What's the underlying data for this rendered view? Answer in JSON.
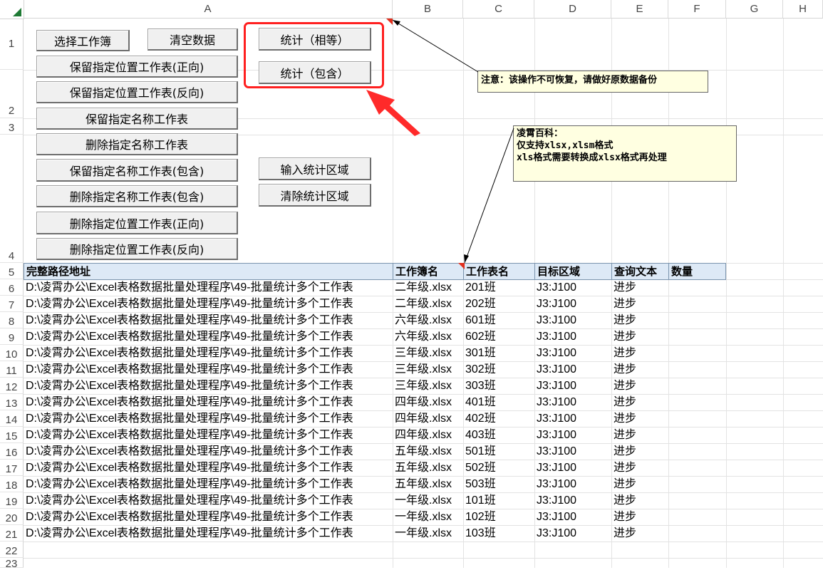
{
  "columns": [
    "A",
    "B",
    "C",
    "D",
    "E",
    "F",
    "G",
    "H"
  ],
  "rows": [
    "1",
    "2",
    "3",
    "4",
    "5",
    "6",
    "7",
    "8",
    "9",
    "10",
    "11",
    "12",
    "13",
    "14",
    "15",
    "16",
    "17",
    "18",
    "19",
    "20",
    "21",
    "22",
    "23"
  ],
  "buttons": {
    "select_workbook": "选择工作簿",
    "clear_data": "清空数据",
    "keep_pos_forward": "保留指定位置工作表(正向)",
    "keep_pos_reverse": "保留指定位置工作表(反向)",
    "keep_name": "保留指定名称工作表",
    "delete_name": "删除指定名称工作表",
    "keep_name_contains": "保留指定名称工作表(包含)",
    "delete_name_contains": "删除指定名称工作表(包含)",
    "delete_pos_forward": "删除指定位置工作表(正向)",
    "delete_pos_reverse": "删除指定位置工作表(反向)",
    "stat_equal": "统计（相等）",
    "stat_contains": "统计（包含）",
    "input_range": "输入统计区域",
    "clear_range": "清除统计区域"
  },
  "notes": {
    "warning": "注意：该操作不可恢复，请做好原数据备份",
    "info_title": "凌霄百科：",
    "info_line1": "仅支持xlsx,xlsm格式",
    "info_line2": "xls格式需要转换成xlsx格式再处理"
  },
  "table": {
    "headers": [
      "完整路径地址",
      "工作簿名",
      "工作表名",
      "目标区域",
      "查询文本",
      "数量"
    ],
    "rows": [
      [
        "D:\\凌霄办公\\Excel表格数据批量处理程序\\49-批量统计多个工作表",
        "二年级.xlsx",
        "201班",
        "J3:J100",
        "进步",
        ""
      ],
      [
        "D:\\凌霄办公\\Excel表格数据批量处理程序\\49-批量统计多个工作表",
        "二年级.xlsx",
        "202班",
        "J3:J100",
        "进步",
        ""
      ],
      [
        "D:\\凌霄办公\\Excel表格数据批量处理程序\\49-批量统计多个工作表",
        "六年级.xlsx",
        "601班",
        "J3:J100",
        "进步",
        ""
      ],
      [
        "D:\\凌霄办公\\Excel表格数据批量处理程序\\49-批量统计多个工作表",
        "六年级.xlsx",
        "602班",
        "J3:J100",
        "进步",
        ""
      ],
      [
        "D:\\凌霄办公\\Excel表格数据批量处理程序\\49-批量统计多个工作表",
        "三年级.xlsx",
        "301班",
        "J3:J100",
        "进步",
        ""
      ],
      [
        "D:\\凌霄办公\\Excel表格数据批量处理程序\\49-批量统计多个工作表",
        "三年级.xlsx",
        "302班",
        "J3:J100",
        "进步",
        ""
      ],
      [
        "D:\\凌霄办公\\Excel表格数据批量处理程序\\49-批量统计多个工作表",
        "三年级.xlsx",
        "303班",
        "J3:J100",
        "进步",
        ""
      ],
      [
        "D:\\凌霄办公\\Excel表格数据批量处理程序\\49-批量统计多个工作表",
        "四年级.xlsx",
        "401班",
        "J3:J100",
        "进步",
        ""
      ],
      [
        "D:\\凌霄办公\\Excel表格数据批量处理程序\\49-批量统计多个工作表",
        "四年级.xlsx",
        "402班",
        "J3:J100",
        "进步",
        ""
      ],
      [
        "D:\\凌霄办公\\Excel表格数据批量处理程序\\49-批量统计多个工作表",
        "四年级.xlsx",
        "403班",
        "J3:J100",
        "进步",
        ""
      ],
      [
        "D:\\凌霄办公\\Excel表格数据批量处理程序\\49-批量统计多个工作表",
        "五年级.xlsx",
        "501班",
        "J3:J100",
        "进步",
        ""
      ],
      [
        "D:\\凌霄办公\\Excel表格数据批量处理程序\\49-批量统计多个工作表",
        "五年级.xlsx",
        "502班",
        "J3:J100",
        "进步",
        ""
      ],
      [
        "D:\\凌霄办公\\Excel表格数据批量处理程序\\49-批量统计多个工作表",
        "五年级.xlsx",
        "503班",
        "J3:J100",
        "进步",
        ""
      ],
      [
        "D:\\凌霄办公\\Excel表格数据批量处理程序\\49-批量统计多个工作表",
        "一年级.xlsx",
        "101班",
        "J3:J100",
        "进步",
        ""
      ],
      [
        "D:\\凌霄办公\\Excel表格数据批量处理程序\\49-批量统计多个工作表",
        "一年级.xlsx",
        "102班",
        "J3:J100",
        "进步",
        ""
      ],
      [
        "D:\\凌霄办公\\Excel表格数据批量处理程序\\49-批量统计多个工作表",
        "一年级.xlsx",
        "103班",
        "J3:J100",
        "进步",
        ""
      ]
    ]
  },
  "colors": {
    "header_fill": "#dde9f6",
    "highlight": "#ff2020",
    "note_fill": "#ffffe1",
    "corner_accent": "#1e7a34"
  }
}
